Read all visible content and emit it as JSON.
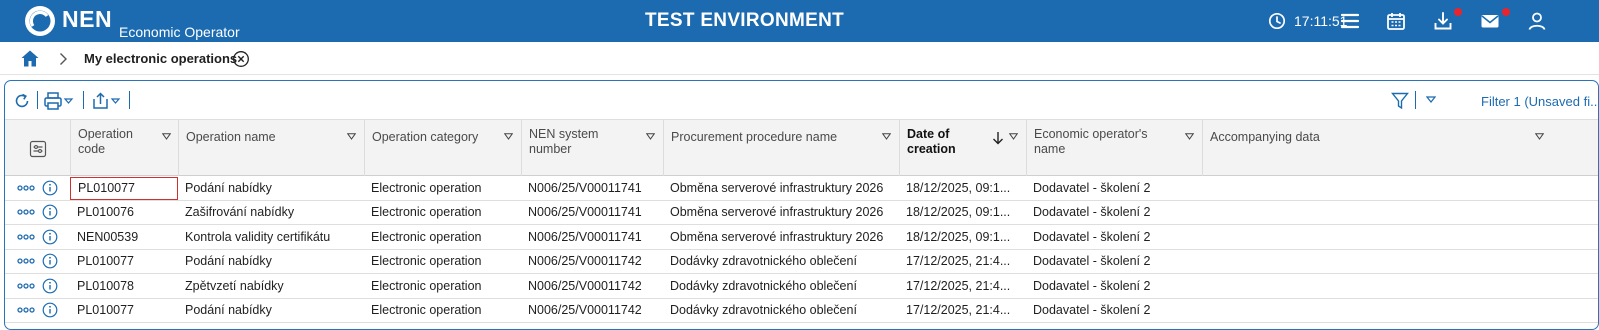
{
  "header": {
    "brand": "NEN",
    "brand_sub": "Economic Operator",
    "environment": "TEST ENVIRONMENT",
    "time": "17:11:51",
    "accent_color": "#1c6bb0",
    "icons": [
      "clock-icon",
      "menu-icon",
      "calendar-icon",
      "download-icon",
      "mail-icon",
      "user-icon"
    ]
  },
  "breadcrumb": {
    "label": "My electronic operations"
  },
  "toolbar": {
    "filter_label": "Filter 1 (Unsaved fi..."
  },
  "table": {
    "columns": [
      "Operation code",
      "Operation name",
      "Operation category",
      "NEN system number",
      "Procurement procedure name",
      "Date of creation",
      "Economic operator's name",
      "Accompanying data"
    ],
    "sorted_column": "Date of creation",
    "sort_direction": "descending",
    "rows": [
      {
        "code": "PL010077",
        "name": "Podání nabídky",
        "category": "Electronic operation",
        "system": "N006/25/V00011741",
        "procedure": "Obměna serverové infrastruktury 2026",
        "date": "18/12/2025, 09:1...",
        "operator": "Dodavatel - školení 2",
        "accompanying": ""
      },
      {
        "code": "PL010076",
        "name": "Zašifrování nabídky",
        "category": "Electronic operation",
        "system": "N006/25/V00011741",
        "procedure": "Obměna serverové infrastruktury 2026",
        "date": "18/12/2025, 09:1...",
        "operator": "Dodavatel - školení 2",
        "accompanying": ""
      },
      {
        "code": "NEN00539",
        "name": "Kontrola validity certifikátu",
        "category": "Electronic operation",
        "system": "N006/25/V00011741",
        "procedure": "Obměna serverové infrastruktury 2026",
        "date": "18/12/2025, 09:1...",
        "operator": "Dodavatel - školení 2",
        "accompanying": ""
      },
      {
        "code": "PL010077",
        "name": "Podání nabídky",
        "category": "Electronic operation",
        "system": "N006/25/V00011742",
        "procedure": "Dodávky zdravotnického oblečení",
        "date": "17/12/2025, 21:4...",
        "operator": "Dodavatel - školení 2",
        "accompanying": ""
      },
      {
        "code": "PL010078",
        "name": "Zpětvzetí nabídky",
        "category": "Electronic operation",
        "system": "N006/25/V00011742",
        "procedure": "Dodávky zdravotnického oblečení",
        "date": "17/12/2025, 21:4...",
        "operator": "Dodavatel - školení 2",
        "accompanying": ""
      },
      {
        "code": "PL010077",
        "name": "Podání nabídky",
        "category": "Electronic operation",
        "system": "N006/25/V00011742",
        "procedure": "Dodávky zdravotnického oblečení",
        "date": "17/12/2025, 21:4...",
        "operator": "Dodavatel - školení 2",
        "accompanying": ""
      }
    ]
  }
}
